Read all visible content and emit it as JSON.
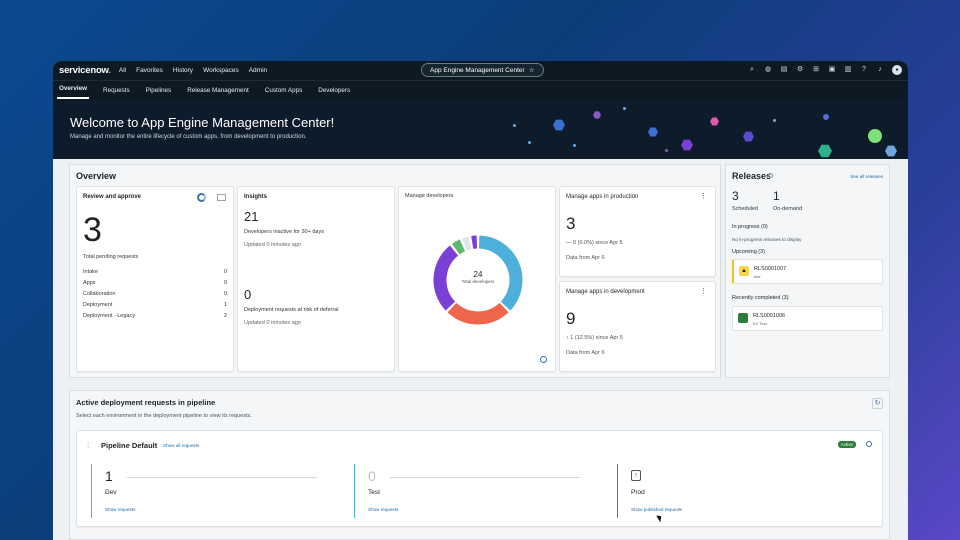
{
  "topbar": {
    "logo_main": "servicenow",
    "logo_dot": ".",
    "nav": [
      "All",
      "Favorites",
      "History",
      "Workspaces",
      "Admin"
    ],
    "app_title": "App Engine Management Center",
    "star": "☆",
    "icons": [
      "search-icon",
      "globe-icon",
      "doc-icon",
      "gear-icon",
      "grid-icon",
      "image-icon",
      "clipboard-icon",
      "help-icon",
      "bell-icon",
      "user-avatar"
    ]
  },
  "tabs": [
    "Overview",
    "Requests",
    "Pipelines",
    "Release Management",
    "Custom Apps",
    "Developers"
  ],
  "hero": {
    "title": "Welcome to App Engine Management Center!",
    "subtitle": "Manage and monitor the entire lifecycle of custom apps, from development to production."
  },
  "overview": {
    "title": "Overview",
    "review": {
      "title": "Review and approve",
      "count": "3",
      "label": "Total pending requests",
      "rows": [
        {
          "name": "Intake",
          "value": "0"
        },
        {
          "name": "Apps",
          "value": "0"
        },
        {
          "name": "Collaboration",
          "value": "0"
        },
        {
          "name": "Deployment",
          "value": "1"
        },
        {
          "name": "Deployment - Legacy",
          "value": "2"
        }
      ]
    },
    "insights": {
      "title": "Insights",
      "n1": "21",
      "t1": "Developers inactive for 30+ days",
      "u1": "Updated 0 minutes ago",
      "n2": "0",
      "t2": "Deployment requests at risk of deferral",
      "u2": "Updated 0 minutes ago"
    },
    "developers": {
      "title": "Manage developers",
      "total": "24",
      "total_label": "Total developers",
      "segments": [
        {
          "value": 9,
          "color": "#4cb0db"
        },
        {
          "value": 6,
          "color": "#f0664a"
        },
        {
          "value": 6.5,
          "color": "#7b3fd6"
        },
        {
          "value": 1,
          "color": "#5ab870"
        },
        {
          "value": 0.8,
          "color": "#e3e3ea"
        },
        {
          "value": 0.7,
          "color": "#7b3fd6"
        }
      ]
    },
    "prod": {
      "title": "Manage apps in production",
      "count": "3",
      "change": "— 0 (0.0%) since Apr 5",
      "from": "Data from Apr 6"
    },
    "dev": {
      "title": "Manage apps in development",
      "count": "9",
      "change": "↑ 1 (12.5%) since Apr 5",
      "from": "Data from Apr 6"
    }
  },
  "releases": {
    "title": "Releases",
    "see_all": "See all releases",
    "scheduled_n": "3",
    "scheduled": "Scheduled",
    "ondemand_n": "1",
    "ondemand": "On-demand",
    "in_progress": "In progress (0)",
    "no_in_progress": "No in-progress releases to display",
    "upcoming": "Upcoming (3)",
    "upcoming_item": {
      "id": "RLS0001007",
      "sub": "test"
    },
    "completed": "Recently completed (3)",
    "completed_item": {
      "id": "RLS0001006",
      "sub": "EV Test"
    }
  },
  "pipeline": {
    "section_title": "Active deployment requests in pipeline",
    "section_sub": "Select each environment in the deployment pipeline to view its requests.",
    "name": "Pipeline Default",
    "show_all": "Show all requests",
    "status": "Active",
    "stages": [
      {
        "count": "1",
        "name": "Dev",
        "link": "Show requests",
        "color": "#4cb0db"
      },
      {
        "count": "0",
        "name": "Test",
        "link": "Show requests",
        "color": "#4cb0db"
      },
      {
        "count": "",
        "name": "Prod",
        "link": "Show published requests",
        "color": "#8a5ac8"
      }
    ]
  }
}
